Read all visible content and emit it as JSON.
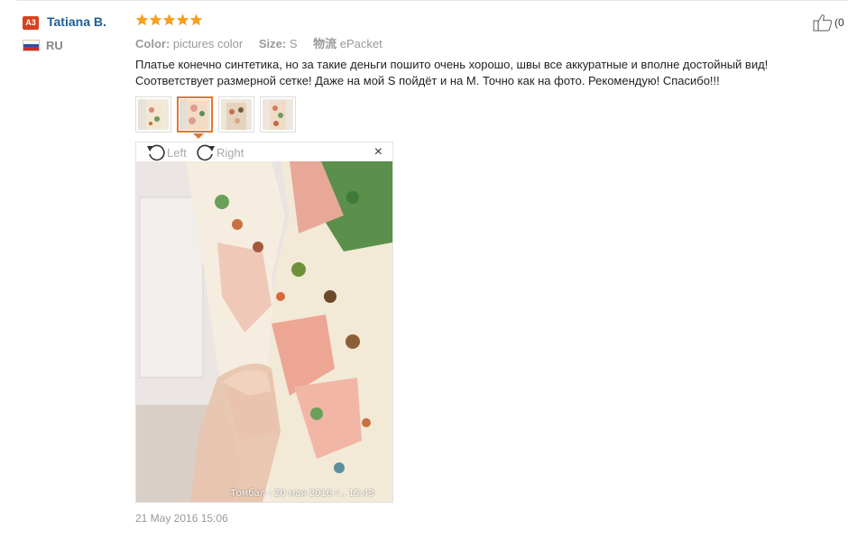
{
  "reviewer": {
    "badge": "A3",
    "name": "Tatiana B.",
    "country": "RU",
    "flag_colors": [
      "#ffffff",
      "#1c52b5",
      "#d52b1e"
    ]
  },
  "rating": {
    "stars": 5,
    "max": 5,
    "color": "#f7a01d"
  },
  "attributes": [
    {
      "label": "Color:",
      "value": "pictures color"
    },
    {
      "label": "Size:",
      "value": "S"
    },
    {
      "label": "物流",
      "value": "ePacket"
    }
  ],
  "review_text": "Платье конечно синтетика, но за такие деньги пошито очень хорошо, швы все аккуратные и вполне достойный вид! Соответствует размерной сетке! Даже на мой S пойдёт и на М. Точно как на фото. Рекомендую! Спасибо!!!",
  "helpful": {
    "icon": "thumbs-up-icon",
    "count": "(0"
  },
  "thumbnails": [
    {
      "name": "photo-1",
      "active": false
    },
    {
      "name": "photo-2",
      "active": true
    },
    {
      "name": "photo-3",
      "active": false
    },
    {
      "name": "photo-4",
      "active": false
    }
  ],
  "viewer": {
    "rotate_left_label": "Left",
    "rotate_right_label": "Right",
    "close_label": "×",
    "photo_caption": "Томбал - 20 мая 2016 г., 15:43"
  },
  "review_date": "21 May 2016 15:06",
  "colors": {
    "name_link": "#1f5d97",
    "accent": "#e5772a",
    "badge": "#d9401e"
  }
}
